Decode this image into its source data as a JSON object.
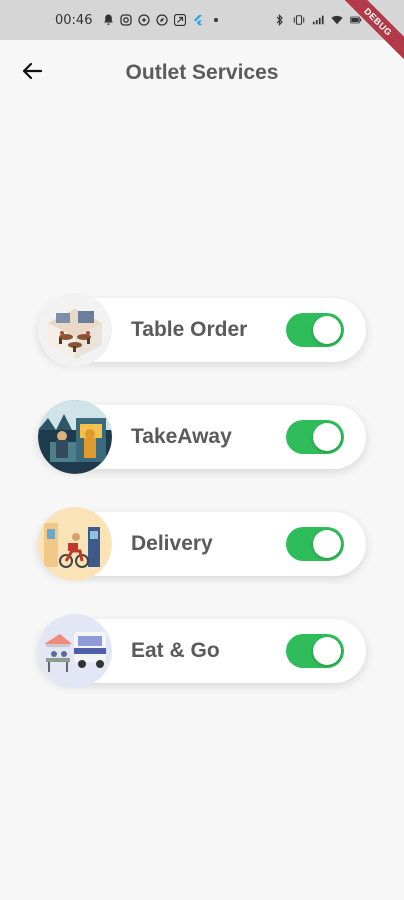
{
  "status_bar": {
    "time": "00:46"
  },
  "debug_banner": "DEBUG",
  "app_bar": {
    "title": "Outlet Services",
    "back_icon": "arrow-back-icon"
  },
  "colors": {
    "toggle_on": "#2ebd5a",
    "title_text": "#5b5b5b",
    "background": "#f7f7f7"
  },
  "services": [
    {
      "label": "Table Order",
      "enabled": true,
      "image": "restaurant-table-illustration"
    },
    {
      "label": "TakeAway",
      "enabled": true,
      "image": "takeaway-counter-illustration"
    },
    {
      "label": "Delivery",
      "enabled": true,
      "image": "delivery-bike-illustration"
    },
    {
      "label": "Eat & Go",
      "enabled": true,
      "image": "food-truck-illustration"
    }
  ]
}
